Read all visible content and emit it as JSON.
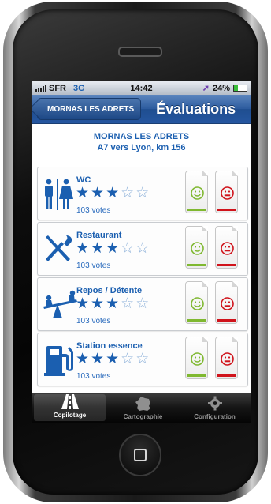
{
  "status_bar": {
    "carrier": "SFR",
    "network": "3G",
    "time": "14:42",
    "battery": "24%"
  },
  "nav": {
    "back_label": "MORNAS LES ADRETS",
    "title": "Évaluations"
  },
  "header": {
    "line1": "MORNAS LES ADRETS",
    "line2": "A7 vers Lyon, km 156"
  },
  "rows": [
    {
      "title": "WC",
      "rating": 3,
      "max_rating": 5,
      "votes": "103 votes",
      "icon": "wc-icon"
    },
    {
      "title": "Restaurant",
      "rating": 3,
      "max_rating": 5,
      "votes": "103 votes",
      "icon": "fork-knife-icon"
    },
    {
      "title": "Repos / Détente",
      "rating": 3,
      "max_rating": 5,
      "votes": "103 votes",
      "icon": "seesaw-icon"
    },
    {
      "title": "Station essence",
      "rating": 3,
      "max_rating": 5,
      "votes": "103 votes",
      "icon": "fuel-pump-icon"
    }
  ],
  "tabs": [
    {
      "label": "Copilotage",
      "icon": "highway-icon",
      "active": true
    },
    {
      "label": "Cartographie",
      "icon": "france-map-icon",
      "active": false
    },
    {
      "label": "Configuration",
      "icon": "gear-icon",
      "active": false
    }
  ],
  "colors": {
    "brand_blue": "#1b5fb0",
    "good_green": "#7fb830",
    "bad_red": "#d0131b",
    "nav_blue": "#2556a0"
  }
}
